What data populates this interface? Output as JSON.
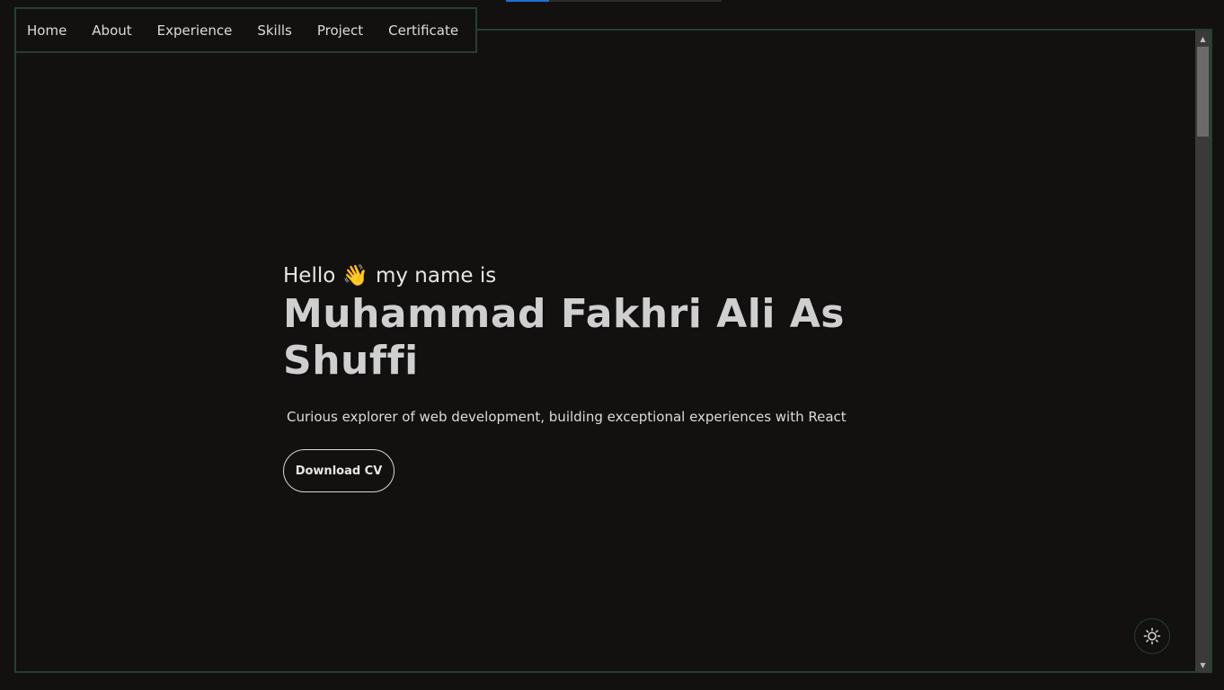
{
  "nav": {
    "items": [
      {
        "label": "Home"
      },
      {
        "label": "About"
      },
      {
        "label": "Experience"
      },
      {
        "label": "Skills"
      },
      {
        "label": "Project"
      },
      {
        "label": "Certificate"
      }
    ]
  },
  "hero": {
    "greeting_before": "Hello",
    "wave_emoji": "👋",
    "greeting_after": "my name is",
    "name": "Muhammad Fakhri Ali As Shuffi",
    "tagline": "Curious explorer of web development, building exceptional experiences with React",
    "download_label": "Download CV"
  },
  "theme_toggle": {
    "icon": "sun-icon"
  },
  "colors": {
    "background": "#131010",
    "border_accent": "#24402f",
    "text": "#e6e6e6",
    "progress_accent": "#1f6fd6"
  }
}
